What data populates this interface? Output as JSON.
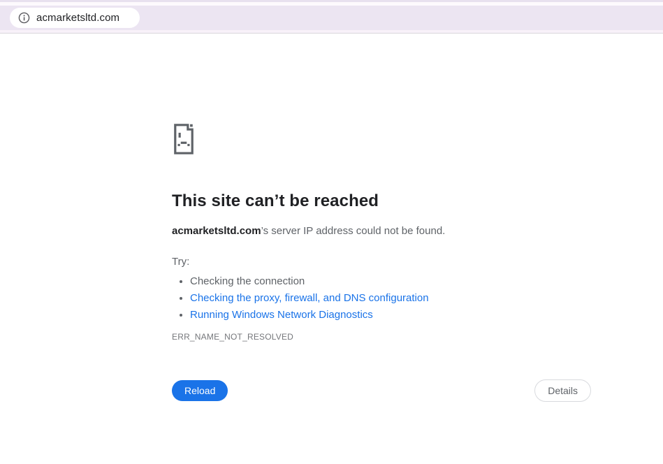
{
  "browser": {
    "url": "acmarketsltd.com"
  },
  "error_page": {
    "title": "This site can’t be reached",
    "subtitle_domain": "acmarketsltd.com",
    "subtitle_rest": "’s server IP address could not be found.",
    "try_label": "Try:",
    "suggestions": [
      {
        "label": "Checking the connection"
      },
      {
        "label": "Checking the proxy, firewall, and DNS configuration"
      },
      {
        "label": "Running Windows Network Diagnostics"
      }
    ],
    "error_code": "ERR_NAME_NOT_RESOLVED",
    "reload_label": "Reload",
    "details_label": "Details"
  },
  "colors": {
    "toolbar_bg": "#ece5f2",
    "link_blue": "#1a73e8",
    "reload_bg": "#1a73e8",
    "icon_gray": "#5f6368"
  }
}
